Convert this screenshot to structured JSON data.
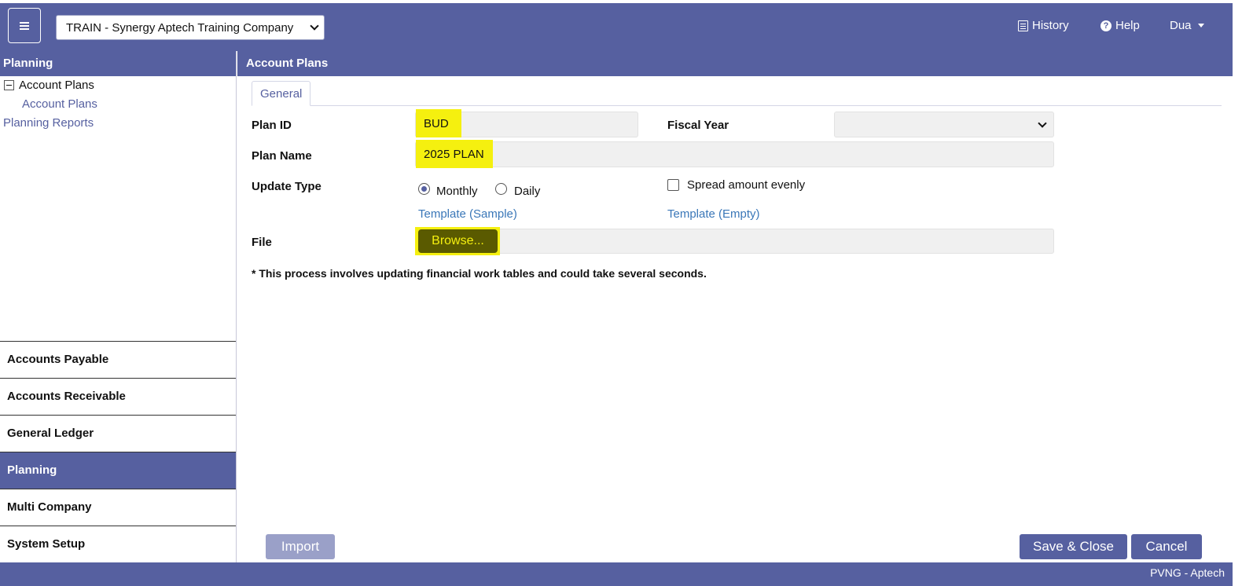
{
  "topbar": {
    "company": "TRAIN - Synergy Aptech Training Company",
    "history": "History",
    "help": "Help",
    "user": "Dua"
  },
  "sidebar": {
    "section_title": "Planning",
    "tree_parent": "Account Plans",
    "tree_child": "Account Plans",
    "reports_link": "Planning Reports",
    "modules": [
      "Accounts Payable",
      "Accounts Receivable",
      "General Ledger",
      "Planning",
      "Multi Company",
      "System Setup"
    ],
    "active_module": "Planning"
  },
  "main": {
    "header": "Account Plans",
    "tab": "General",
    "form": {
      "plan_id_label": "Plan ID",
      "plan_id_value": "BUD",
      "fiscal_year_label": "Fiscal Year",
      "fiscal_year_value": "",
      "plan_name_label": "Plan Name",
      "plan_name_value": "2025 PLAN",
      "update_type_label": "Update Type",
      "monthly": "Monthly",
      "daily": "Daily",
      "update_type_selected": "Monthly",
      "spread_label": "Spread amount evenly",
      "spread_checked": false,
      "template_sample": "Template (Sample)",
      "template_empty": "Template (Empty)",
      "file_label": "File",
      "browse": "Browse..."
    },
    "note": "* This process involves updating financial work tables and could take several seconds.",
    "buttons": {
      "import": "Import",
      "save_close": "Save & Close",
      "cancel": "Cancel"
    }
  },
  "footer": {
    "text": "PVNG - Aptech"
  },
  "colors": {
    "brand": "#5660a0",
    "highlight": "#f5f00f",
    "link": "#3a77b8",
    "disabled_button": "#9aa0c8"
  }
}
